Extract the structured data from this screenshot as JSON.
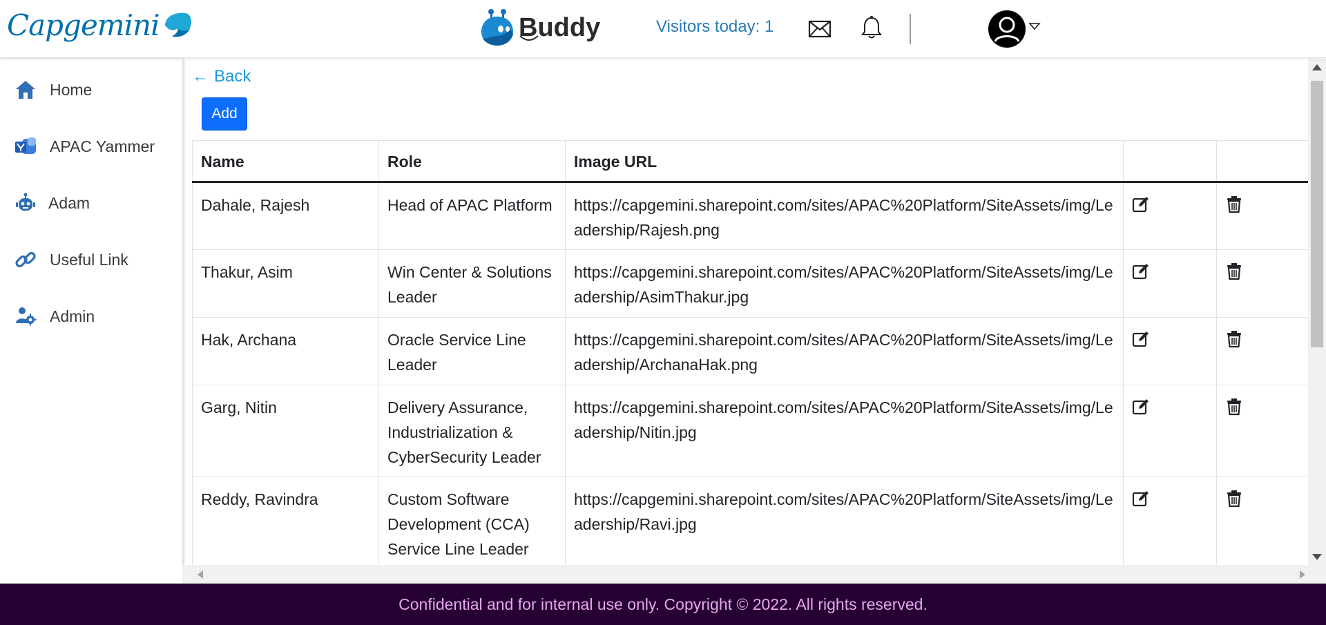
{
  "header": {
    "logo_text": "Capgemini",
    "app_name": "Buddy",
    "visitors": "Visitors today: 1",
    "icons": {
      "mail": "mail-icon",
      "bell": "bell-icon",
      "avatar": "user-avatar-icon",
      "caret": "caret-down-icon"
    }
  },
  "sidebar": {
    "items": [
      {
        "label": "Home",
        "icon": "home-icon"
      },
      {
        "label": "APAC Yammer",
        "icon": "yammer-icon"
      },
      {
        "label": "Adam",
        "icon": "robot-icon"
      },
      {
        "label": "Useful Link",
        "icon": "link-icon"
      },
      {
        "label": "Admin",
        "icon": "admin-users-icon"
      }
    ]
  },
  "main": {
    "back_label": "Back",
    "add_label": "Add",
    "table": {
      "columns": [
        "Name",
        "Role",
        "Image URL",
        "",
        ""
      ],
      "rows": [
        {
          "name": "Dahale, Rajesh",
          "role": "Head of APAC Platform",
          "url": "https://capgemini.sharepoint.com/sites/APAC%20Platform/SiteAssets/img/Leadership/Rajesh.png"
        },
        {
          "name": "Thakur, Asim",
          "role": "Win Center & Solutions Leader",
          "url": "https://capgemini.sharepoint.com/sites/APAC%20Platform/SiteAssets/img/Leadership/AsimThakur.jpg"
        },
        {
          "name": "Hak, Archana",
          "role": "Oracle Service Line Leader",
          "url": "https://capgemini.sharepoint.com/sites/APAC%20Platform/SiteAssets/img/Leadership/ArchanaHak.png"
        },
        {
          "name": "Garg, Nitin",
          "role": "Delivery Assurance, Industrialization & CyberSecurity Leader",
          "url": "https://capgemini.sharepoint.com/sites/APAC%20Platform/SiteAssets/img/Leadership/Nitin.jpg"
        },
        {
          "name": "Reddy, Ravindra",
          "role": "Custom Software Development (CCA) Service Line Leader",
          "url": "https://capgemini.sharepoint.com/sites/APAC%20Platform/SiteAssets/img/Leadership/Ravi.jpg"
        }
      ]
    }
  },
  "footer": {
    "text": "Confidential and for internal use only. Copyright © 2022. All rights reserved."
  },
  "colors": {
    "brand_blue": "#0070ad",
    "add_button": "#0d6efd",
    "footer_bg": "#260033",
    "footer_text": "#e7a6f2",
    "visitors_text": "#2a7bb5",
    "back_link": "#1a9bd7"
  }
}
